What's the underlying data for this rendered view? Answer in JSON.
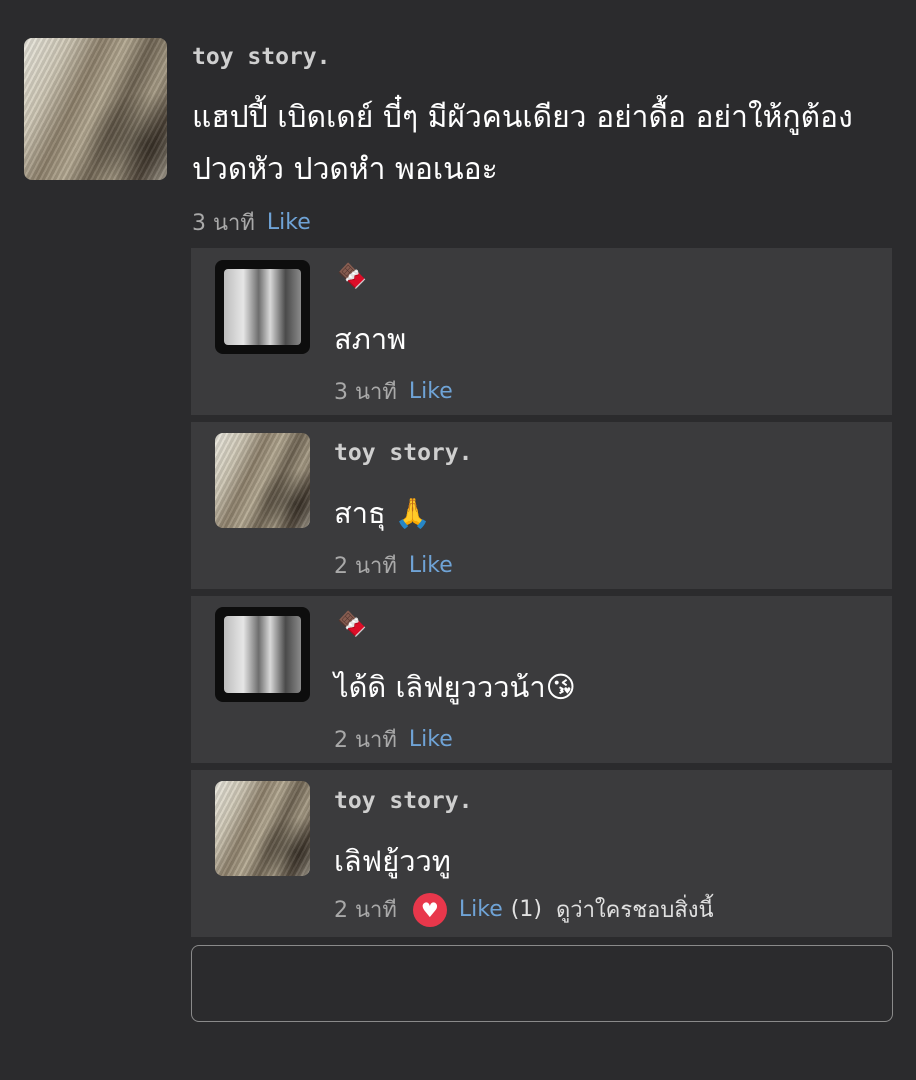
{
  "post": {
    "author": "toy story.",
    "text": "แฮปปี้ เบิดเดย์ บี๋ๆ มีผัวคนเดียว อย่าดื้อ อย่าให้กูต้องปวดหัว ปวดหำ พอเนอะ",
    "time": "3 นาที",
    "like_label": "Like"
  },
  "replies": [
    {
      "author": "🍫",
      "text": "สภาพ",
      "time": "3 นาที",
      "like_label": "Like"
    },
    {
      "author": "toy story.",
      "text": "สาธุ 🙏",
      "time": "2 นาที",
      "like_label": "Like"
    },
    {
      "author": "🍫",
      "text": "ได้ดิ เลิฟยูวววน้า😘",
      "time": "2 นาที",
      "like_label": "Like"
    },
    {
      "author": "toy story.",
      "text": "เลิฟยู้ววทู",
      "time": "2 นาที",
      "like_label": "Like",
      "like_count": "(1)",
      "who_liked": "ดูว่าใครชอบสิ่งนี้"
    }
  ],
  "colors": {
    "background": "#2b2b2d",
    "reply_background": "#3b3b3d",
    "like_link": "#6fa3d6",
    "heart": "#e8374b"
  },
  "icons": {
    "reaction": "heart-icon",
    "emoji_name": "chocolate-bar-emoji"
  }
}
